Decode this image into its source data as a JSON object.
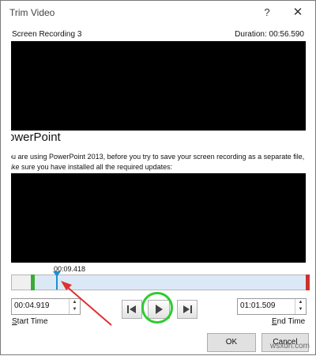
{
  "window": {
    "title": "Trim Video",
    "help_icon": "?",
    "close_icon": "✕"
  },
  "clip": {
    "name": "Screen Recording 3",
    "duration": "Duration: 00:56.590"
  },
  "video": {
    "title": "owerPoint",
    "line1": "ou are using PowerPoint 2013, before you try to save your screen recording as a separate file, check to",
    "line2": "ake sure you have installed all the required updates:"
  },
  "timeline": {
    "current_time": "00:09.418",
    "playhead_fraction": 0.148
  },
  "start": {
    "value": "00:04.919",
    "label": "Start Time"
  },
  "end": {
    "value": "01:01.509",
    "label": "End Time"
  },
  "controls": {
    "prev_icon": "previous-frame-icon",
    "play_icon": "play-icon",
    "next_icon": "next-frame-icon"
  },
  "buttons": {
    "ok": "OK",
    "cancel": "Cancel"
  },
  "watermark": "wsxdn.com"
}
